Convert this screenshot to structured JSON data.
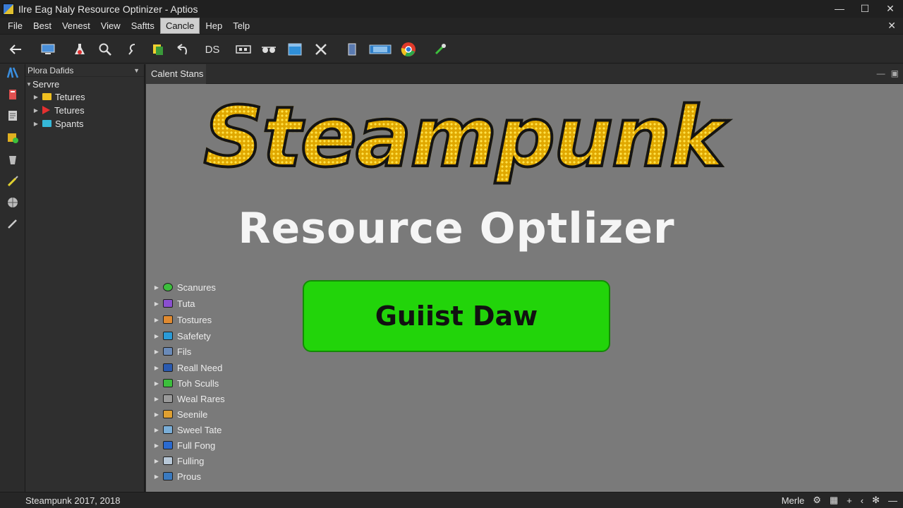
{
  "window": {
    "title": "Ilre Eag  Naly  Resource Optinizer - Aptios",
    "controls": [
      "—",
      "☐",
      "✕"
    ]
  },
  "menu": {
    "items": [
      "File",
      "Best",
      "Venest",
      "View",
      "Saftts",
      "Cancle",
      "Hep",
      "Telp"
    ],
    "active": "Cancle",
    "close_glyph": "✕"
  },
  "toolbar": {
    "icons": [
      "back-arrow-icon",
      "monitor-icon",
      "flask-icon",
      "magnifier-icon",
      "hook-icon",
      "notes-icon",
      "undo-icon",
      "ds-icon",
      "film-icon",
      "glasses-icon",
      "window-icon",
      "tools-icon",
      "phone-icon",
      "panel-icon",
      "chrome-icon",
      "pipette-icon"
    ],
    "ds_label": "DS"
  },
  "rail": {
    "icons": [
      "logo-icon",
      "book-icon",
      "document-icon",
      "folder-plus-icon",
      "bucket-icon",
      "pen-icon",
      "globe-icon",
      "brush-icon"
    ]
  },
  "explorer": {
    "header": "Plora Dafids",
    "root": "Servre",
    "children": [
      {
        "label": "Tetures",
        "icon": "folder-icon",
        "color": "#f0c020"
      },
      {
        "label": "Tetures",
        "icon": "triangle-icon",
        "color": "#e53030"
      },
      {
        "label": "Spants",
        "icon": "folder-icon",
        "color": "#35b8d8"
      }
    ]
  },
  "tab": {
    "label": "Calent Stans"
  },
  "hero": {
    "title": "Steampunk",
    "subtitle": "Resource Optlizer",
    "button_label": "Guiist Daw",
    "title_color": "#f2c21a",
    "button_color": "#22d40a"
  },
  "asset_list": [
    {
      "label": "Scanures",
      "color": "#3cbf3c"
    },
    {
      "label": "Tuta",
      "color": "#8a4fd0"
    },
    {
      "label": "Tostures",
      "color": "#e08a30"
    },
    {
      "label": "Safefety",
      "color": "#2a9bd8"
    },
    {
      "label": "Fils",
      "color": "#6a8ab8"
    },
    {
      "label": "Reall Need",
      "color": "#2a5ab0"
    },
    {
      "label": "Toh Sculls",
      "color": "#3cbf3c"
    },
    {
      "label": "Weal Rares",
      "color": "#9a9a9a"
    },
    {
      "label": "Seenile",
      "color": "#e0a030"
    },
    {
      "label": "Sweel Tate",
      "color": "#7aaed8"
    },
    {
      "label": "Full Fong",
      "color": "#2a6ad0"
    },
    {
      "label": "Fulling",
      "color": "#b8c8d8"
    },
    {
      "label": "Prous",
      "color": "#3a7ac0"
    }
  ],
  "status": {
    "left": "Steampunk 2017, 2018",
    "mode": "Merle",
    "icons": [
      "settings-icon",
      "grid-icon",
      "plus-icon",
      "chevron-left-icon",
      "gear-icon",
      "minus-icon"
    ]
  }
}
